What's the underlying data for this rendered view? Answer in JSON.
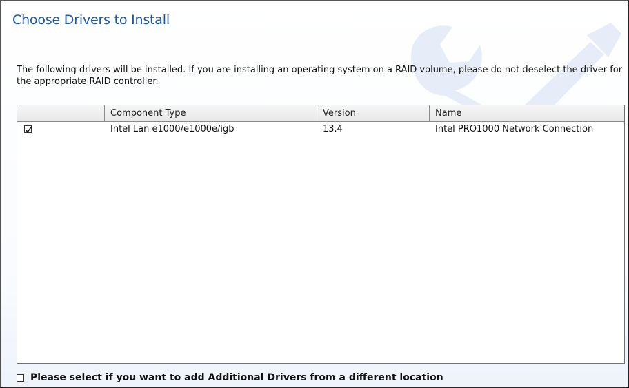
{
  "dialog": {
    "title": "Choose Drivers to Install",
    "description": "The following drivers will be installed. If you are installing an operating system on a RAID volume, please do not deselect the driver for the appropriate RAID controller."
  },
  "table": {
    "columns": [
      "",
      "Component Type",
      "Version",
      "Name"
    ],
    "rows": [
      {
        "checked": true,
        "component_type": "Intel Lan e1000/e1000e/igb",
        "version": "13.4",
        "name": "Intel PRO1000 Network Connection"
      }
    ]
  },
  "footer": {
    "checked": false,
    "label": "Please select if you want to add Additional Drivers from a different location"
  },
  "colors": {
    "title": "#1a5aa8",
    "watermark": "#e6edf8"
  },
  "icons": {
    "watermark": "wrench-watermark-icon",
    "check": "checkmark-icon"
  }
}
